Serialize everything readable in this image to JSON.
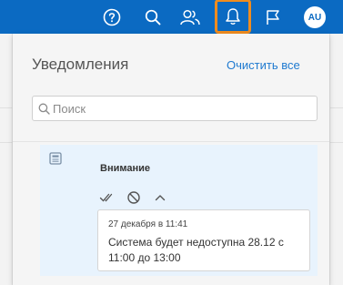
{
  "topbar": {
    "icons": [
      "help-icon",
      "search-icon",
      "users-icon",
      "bell-icon",
      "flag-icon"
    ],
    "avatar_initials": "AU",
    "background": "#0b6ac2",
    "active_highlight": "#f08c1e"
  },
  "panel": {
    "title": "Уведомления",
    "clear_all_label": "Очистить все",
    "search": {
      "placeholder": "Поиск",
      "value": ""
    }
  },
  "notification": {
    "icon": "document-icon",
    "heading": "Внимание",
    "actions": [
      "check-all-icon",
      "block-icon",
      "chevron-up-icon"
    ],
    "time": "27 декабря в 11:41",
    "message": "Система будет недоступна 28.12 с 11:00 до 13:00"
  }
}
